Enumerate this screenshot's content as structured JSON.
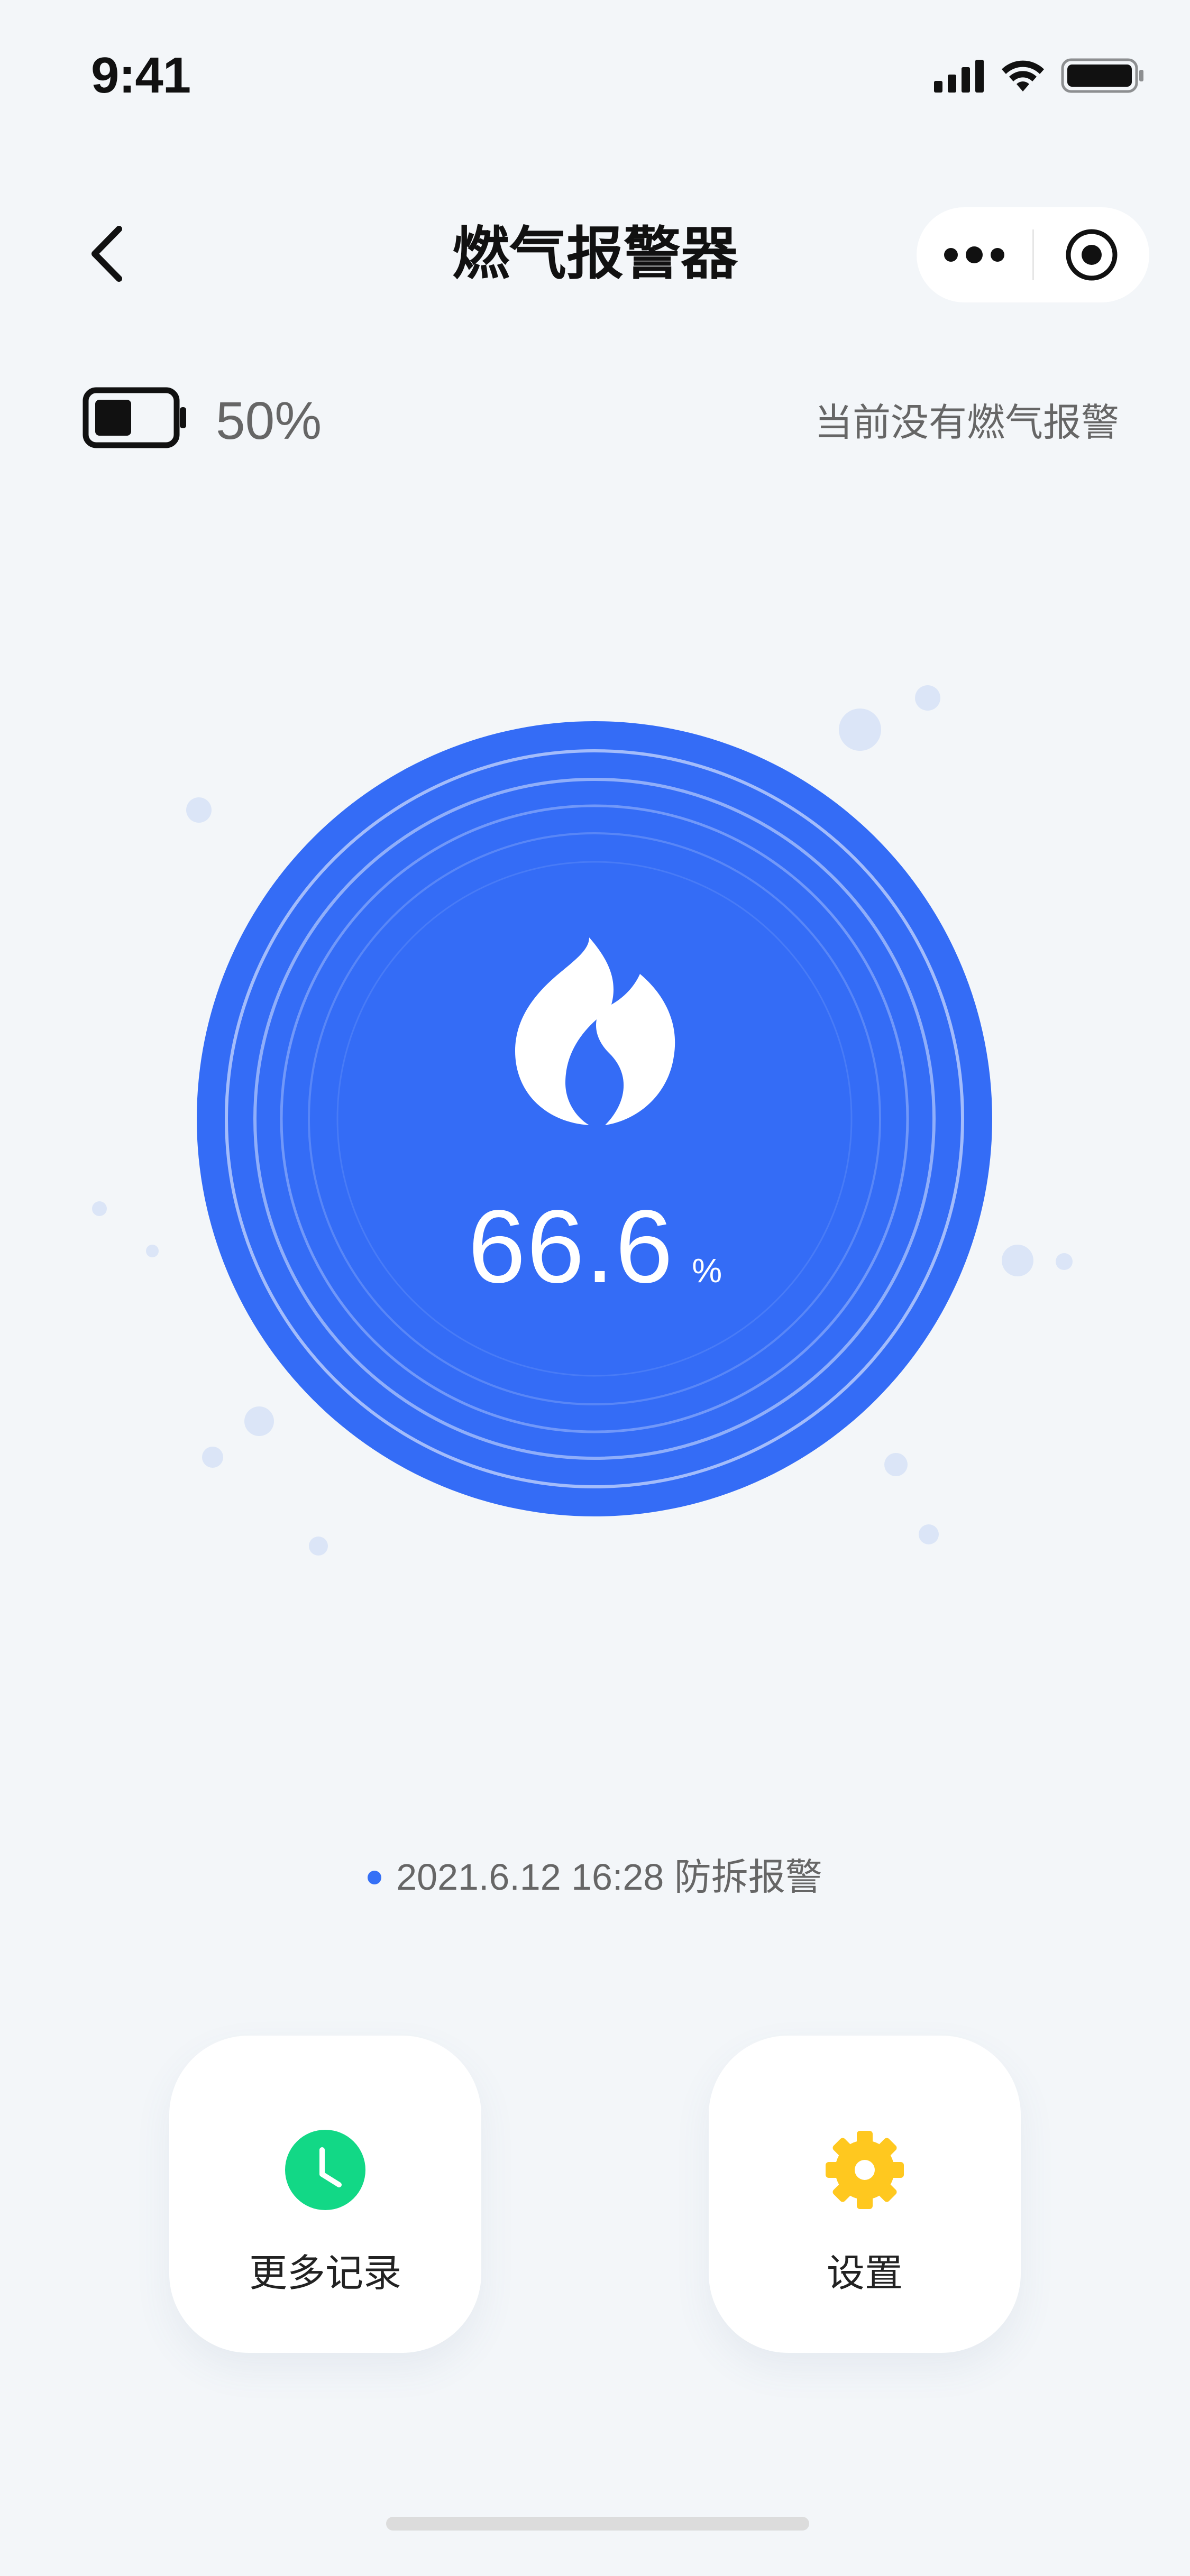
{
  "status_bar": {
    "time": "9:41"
  },
  "nav": {
    "title": "燃气报警器"
  },
  "device": {
    "battery_percent_label": "50%",
    "battery_level": 0.5,
    "alarm_status": "当前没有燃气报警"
  },
  "gauge": {
    "value": "66.6",
    "unit": "%",
    "color": "#346cf6"
  },
  "latest_record": {
    "text": "2021.6.12 16:28 防拆报警"
  },
  "cards": {
    "records_label": "更多记录",
    "settings_label": "设置"
  },
  "colors": {
    "background": "#f3f6f9",
    "primary": "#346cf6",
    "green": "#12d886",
    "yellow": "#ffc81f"
  }
}
